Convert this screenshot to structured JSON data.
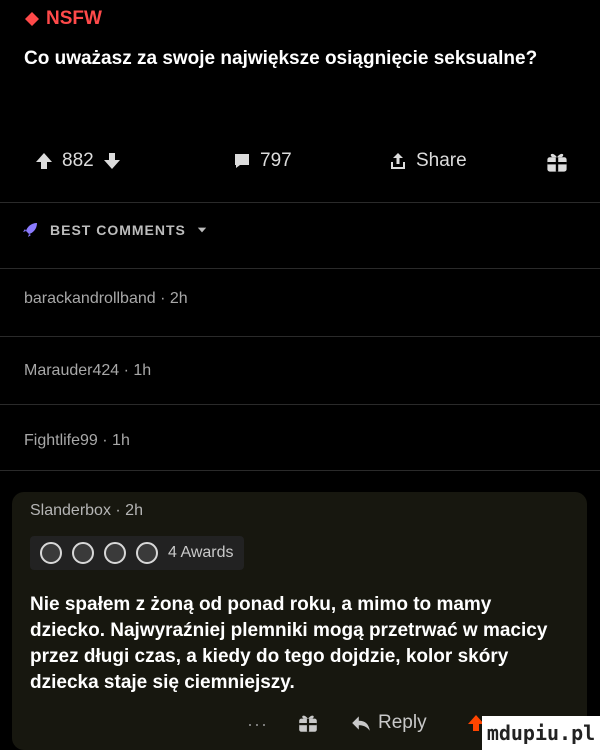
{
  "post": {
    "flair": "NSFW",
    "title": "Co uważasz za swoje największe osiągnięcie seksualne?"
  },
  "actions": {
    "upvotes": "882",
    "comments": "797",
    "share_label": "Share"
  },
  "comments_header": {
    "label": "BEST COMMENTS"
  },
  "comments": [
    {
      "author_meta": "barackandrollband · 2h"
    },
    {
      "author_meta": "Marauder424 · 1h"
    },
    {
      "author_meta": "Fightlife99 · 1h"
    }
  ],
  "featured_comment": {
    "author_meta": "Slanderbox · 2h",
    "awards_label": "4 Awards",
    "text": "Nie spałem z żoną od ponad roku, a mimo to mamy dziecko. Najwyraźniej plemniki mogą przetrwać w macicy przez długi czas, a kiedy do tego dojdzie, kolor skóry dziecka staje się ciemniejszy.",
    "more_label": "···",
    "reply_label": "Reply"
  },
  "watermark": "mdupiu.pl",
  "colors": {
    "nsfw": "#ff4a4a",
    "background": "#000000",
    "card": "#17170f"
  }
}
